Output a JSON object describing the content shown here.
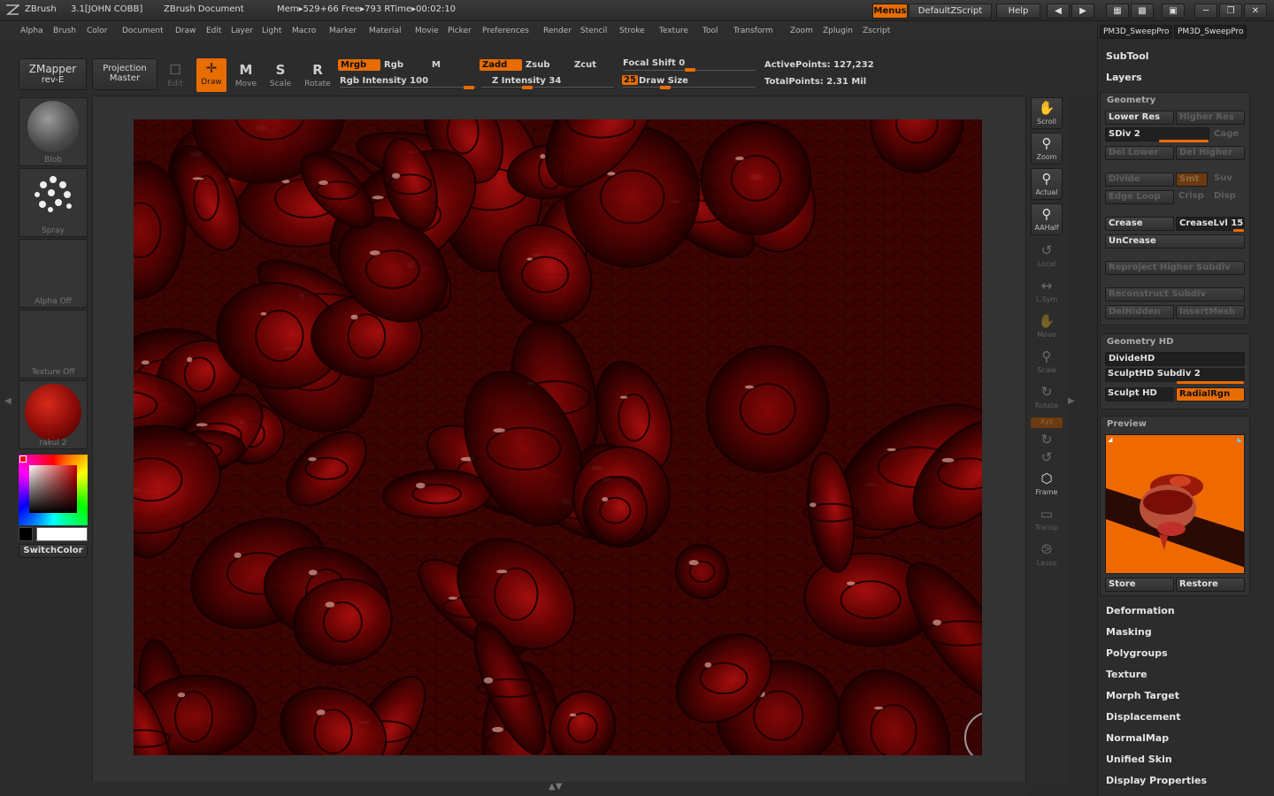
{
  "titlebar": {
    "app": "ZBrush",
    "version": "3.1[JOHN COBB]",
    "document": "ZBrush Document",
    "mem": "Mem▸529+66 Free▸793 RTime▸00:02:10",
    "menus_label": "Menus",
    "zscript_label": "DefaultZScript",
    "help_label": "Help"
  },
  "menubar": {
    "items": [
      "Alpha",
      "Brush",
      "Color",
      "Document",
      "Draw",
      "Edit",
      "Layer",
      "Light",
      "Macro",
      "Marker",
      "Material",
      "Movie",
      "Picker",
      "Preferences",
      "Render",
      "Stencil",
      "Stroke",
      "Texture",
      "Tool",
      "Transform",
      "Zoom",
      "Zplugin",
      "Zscript"
    ]
  },
  "toolbar": {
    "zmapper": "ZMapper",
    "zmapper_sub": "rev-E",
    "projection": "Projection",
    "projection_sub": "Master",
    "tools": [
      {
        "label": "Edit",
        "glyph": "☐"
      },
      {
        "label": "Draw",
        "glyph": "✛"
      },
      {
        "label": "Move",
        "glyph": "M"
      },
      {
        "label": "Scale",
        "glyph": "S"
      },
      {
        "label": "Rotate",
        "glyph": "R"
      }
    ],
    "mrgb": "Mrgb",
    "rgb": "Rgb",
    "m": "M",
    "rgb_intensity": "Rgb Intensity 100",
    "zadd": "Zadd",
    "zsub": "Zsub",
    "zcut": "Zcut",
    "z_intensity": "Z Intensity 34",
    "focal_shift": "Focal Shift 0",
    "draw_size_value": "25",
    "draw_size": "Draw Size",
    "active_points": "ActivePoints: 127,232",
    "total_points": "TotalPoints: 2.31 Mil"
  },
  "leftshelf": {
    "tiles": [
      "Blob",
      "Spray",
      "Alpha Off",
      "Texture Off",
      "rakul 2"
    ],
    "switch_color": "SwitchColor"
  },
  "rightstrip": {
    "buttons": [
      "Scroll",
      "Zoom",
      "Actual",
      "AAHalf"
    ],
    "dim_buttons": [
      "Local",
      "L.Sym",
      "Move",
      "Scale",
      "Rotate",
      "Xyz",
      "",
      "",
      "Frame",
      "Transp",
      "Lasso"
    ]
  },
  "rightpanel": {
    "tabs": [
      "PM3D_SweepPro",
      "PM3D_SweepPro"
    ],
    "subtool": "SubTool",
    "layers": "Layers",
    "geometry": {
      "title": "Geometry",
      "lower_res": "Lower Res",
      "higher_res": "Higher Res",
      "sdiv": "SDiv 2",
      "cage": "Cage",
      "del_lower": "Del Lower",
      "del_higher": "Del Higher",
      "divide": "Divide",
      "smt": "Smt",
      "suv": "Suv",
      "edge_loop": "Edge Loop",
      "crisp": "Crisp",
      "disp": "Disp",
      "crease": "Crease",
      "crease_lvl": "CreaseLvl 15",
      "uncrease": "UnCrease",
      "reproject": "Reproject Higher Subdiv",
      "reconstruct": "Reconstruct Subdiv",
      "delhidden": "DelHidden",
      "insertmesh": "InsertMesh"
    },
    "geometry_hd": {
      "title": "Geometry HD",
      "dividehd": "DivideHD",
      "sculpthd_subdiv": "SculptHD Subdiv 2",
      "sculpt_hd": "Sculpt HD",
      "radialrgn": "RadialRgn"
    },
    "preview": {
      "title": "Preview",
      "store": "Store",
      "restore": "Restore"
    },
    "menu_items": [
      "Deformation",
      "Masking",
      "Polygroups",
      "Texture",
      "Morph Target",
      "Displacement",
      "NormalMap",
      "Unified Skin",
      "Display Properties"
    ]
  }
}
